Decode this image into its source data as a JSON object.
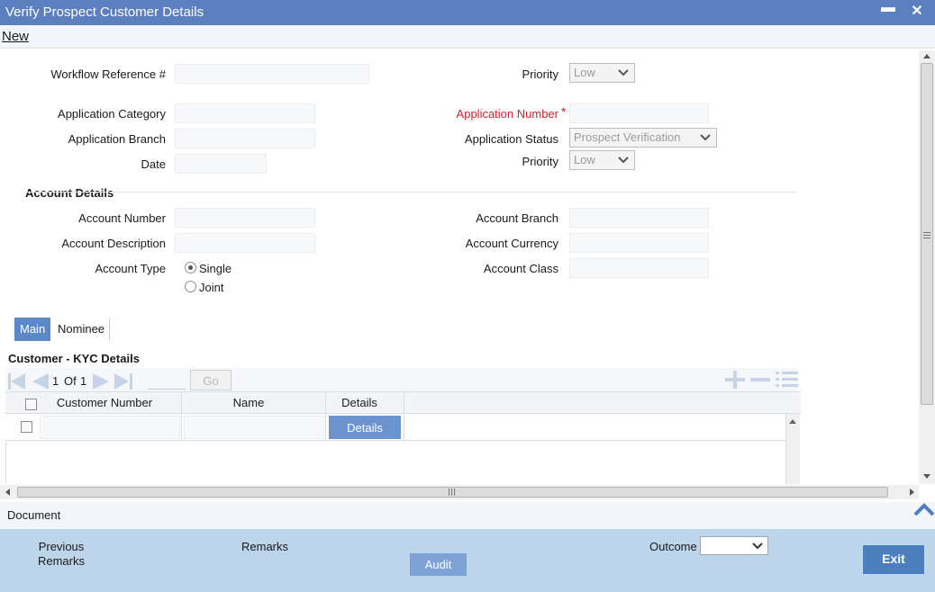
{
  "window": {
    "title": "Verify Prospect Customer Details",
    "minimize_glyph": "▬",
    "close_glyph": "✕"
  },
  "menu": {
    "new_label": "New"
  },
  "header_fields": {
    "workflow_ref_label": "Workflow Reference #",
    "priority_label": "Priority",
    "priority_value": "Low",
    "app_category_label": "Application Category",
    "app_number_label": "Application Number",
    "required_marker": "*",
    "app_branch_label": "Application Branch",
    "app_status_label": "Application Status",
    "app_status_value": "Prospect Verification",
    "date_label": "Date",
    "priority2_label": "Priority",
    "priority2_value": "Low"
  },
  "account": {
    "section_title": "Account Details",
    "number_label": "Account Number",
    "branch_label": "Account Branch",
    "description_label": "Account Description",
    "currency_label": "Account Currency",
    "type_label": "Account Type",
    "class_label": "Account Class",
    "type_options": [
      "Single",
      "Joint"
    ],
    "type_selected": "Single"
  },
  "tabs": [
    {
      "label": "Main",
      "active": true
    },
    {
      "label": "Nominee",
      "active": false
    }
  ],
  "kyc": {
    "title": "Customer - KYC Details",
    "page_current": "1",
    "page_of": "Of",
    "page_total": "1",
    "go_label": "Go",
    "columns": [
      "Customer Number",
      "Name",
      "Details"
    ],
    "rows": [
      {
        "customer_number": "",
        "name": "",
        "details_button": "Details"
      }
    ]
  },
  "document_label": "Document",
  "footer": {
    "previous_remarks_line1": "Previous",
    "previous_remarks_line2": "Remarks",
    "remarks_label": "Remarks",
    "audit_label": "Audit",
    "outcome_label": "Outcome",
    "outcome_value": "",
    "exit_label": "Exit"
  },
  "colors": {
    "titlebar": "#5b7fbf",
    "accent": "#5b89c8",
    "required": "#cc1f2e",
    "footer": "#bcd5ea",
    "exit_button": "#4c7fbf"
  }
}
